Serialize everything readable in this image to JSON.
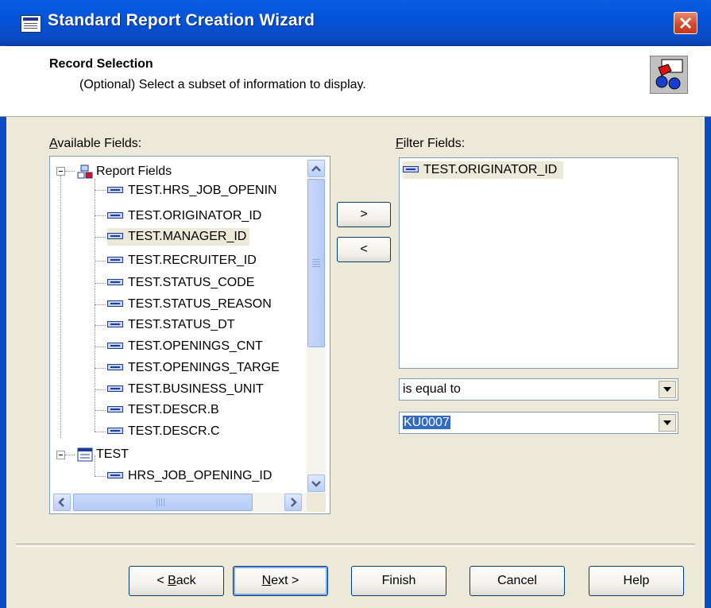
{
  "window": {
    "title": "Standard Report Creation Wizard"
  },
  "header": {
    "title": "Record Selection",
    "subtitle": "(Optional)  Select a subset of information to display."
  },
  "available": {
    "label_underlined": "A",
    "label_rest": "vailable Fields:",
    "root1": "Report Fields",
    "fields": [
      "TEST.HRS_JOB_OPENIN",
      "TEST.ORIGINATOR_ID",
      "TEST.MANAGER_ID",
      "TEST.RECRUITER_ID",
      "TEST.STATUS_CODE",
      "TEST.STATUS_REASON",
      "TEST.STATUS_DT",
      "TEST.OPENINGS_CNT",
      "TEST.OPENINGS_TARGE",
      "TEST.BUSINESS_UNIT",
      "TEST.DESCR.B",
      "TEST.DESCR.C"
    ],
    "root2": "TEST",
    "child": "HRS_JOB_OPENING_ID"
  },
  "move": {
    "add": ">",
    "remove": "<"
  },
  "filter": {
    "label_underlined": "F",
    "label_rest": "ilter Fields:",
    "items": [
      "TEST.ORIGINATOR_ID"
    ],
    "operator": "is equal to",
    "value": "KU0007"
  },
  "footer": {
    "back_u": "B",
    "back_rest": "ack",
    "back_prefix": "< ",
    "next_u": "N",
    "next_rest": "ext >",
    "finish": "Finish",
    "cancel": "Cancel",
    "help": "Help"
  },
  "colors": {
    "titlebar": "#0353d9",
    "selection": "#316ac5",
    "close": "#d4452a"
  }
}
